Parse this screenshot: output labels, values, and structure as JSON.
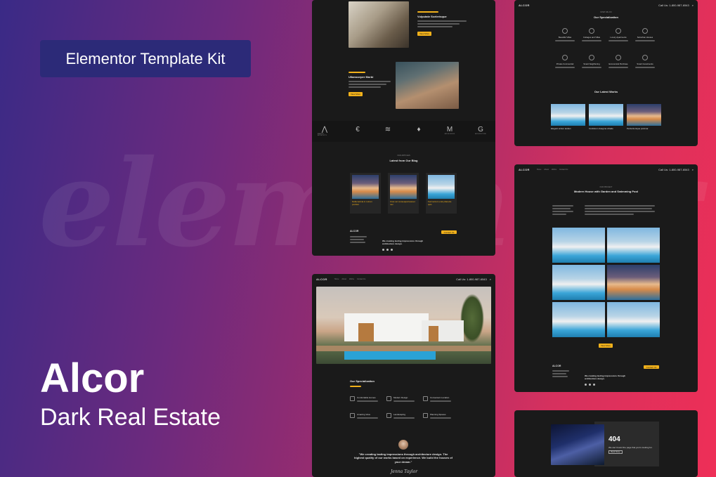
{
  "promo": {
    "badge_label": "Elementor Template Kit",
    "watermark": "elementor",
    "title": "Alcor",
    "subtitle": "Dark Real Estate"
  },
  "panel1": {
    "item1_title": "Vulputate Scelerisque",
    "item1_btn": "View More",
    "item2_title": "Ullamcorper Morbi",
    "item2_btn": "View More",
    "partners": [
      "AMAZON ARCHITECTS",
      "",
      "",
      "",
      "ARCHI DESIGN",
      "ARCHITECTURE"
    ],
    "blog_kicker": "OUR ARTICLES",
    "blog_title": "Latest from Our Blog",
    "blog_posts": [
      "Nulla lacinia in rutrum porttitor",
      "Cras vel consequat laoreet nec",
      "Fermentum erat pharetra quis"
    ],
    "footer_logo": "ALCOR",
    "footer_tagline": "We creating lasting impressions through architecture design.",
    "footer_btn": "Contact Us"
  },
  "panel2": {
    "logo": "ALCOR",
    "nav": [
      "Home",
      "About",
      "Works",
      "Contact Us"
    ],
    "phone": "Call Us: 1-800-987-6543",
    "spec_title": "Our Specialization",
    "features": [
      "Comfortable Homes",
      "Modern Design",
      "Convenient Location",
      "Amazing View",
      "Landscaping",
      "Planning Spaces"
    ],
    "quote": "\"We creating lasting impressions through architecture design. The highest quality of our works based on experience. We build the houses of your dream.\"",
    "signature": "Jenna Taylor"
  },
  "panel3": {
    "logo": "ALCOR",
    "phone": "Call Us: 1-800-987-6543",
    "spec_kicker": "WHAT WE DO",
    "spec_title": "Our Specialization",
    "specs": [
      "Beautiful Villas",
      "Cottages and Villas",
      "Luxury Apartments",
      "Suburban Houses",
      "Private Commercial",
      "Smart Neighboring",
      "Economical Purchase",
      "Smart Investments"
    ],
    "works_title": "Our Latest Works",
    "works": [
      "Elegant winter tavilan",
      "Cantistum doagma vittade",
      "Perfectionique pulvinar"
    ]
  },
  "panel4": {
    "logo": "ALCOR",
    "nav": [
      "Home",
      "About",
      "Works",
      "Contact Us"
    ],
    "phone": "Call Us: 1-800-987-6543",
    "kicker": "OUR PROJECT",
    "title": "Modern House with Garden and Swimming Pool",
    "gallery_btn": "View More",
    "footer_logo": "ALCOR",
    "footer_tagline": "We creating lasting impressions through architecture design.",
    "footer_btn": "Contact Us"
  },
  "panel5": {
    "code": "404",
    "message": "We can't found the page that you're looking for.",
    "btn": "Back Home"
  }
}
